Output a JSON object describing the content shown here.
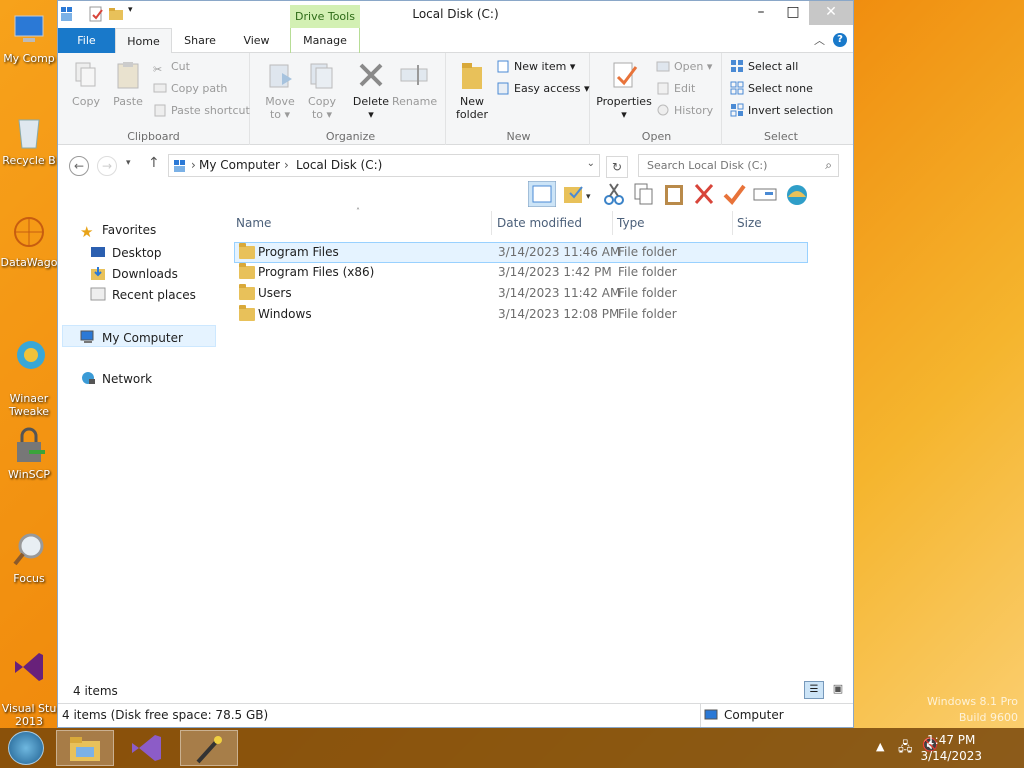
{
  "desktop": {
    "icons": [
      {
        "label": "My Comp"
      },
      {
        "label": "Recycle B"
      },
      {
        "label": "DataWago"
      },
      {
        "label": "Winaer\nTweake"
      },
      {
        "label": "WinSCP"
      },
      {
        "label": "Focus"
      },
      {
        "label": "Visual Stu\n2013"
      }
    ],
    "watermark_line1": "Windows 8.1 Pro",
    "watermark_line2": "Build 9600"
  },
  "window": {
    "title": "Local Disk (C:)",
    "contextual_tab": "Drive Tools",
    "tabs": {
      "file": "File",
      "home": "Home",
      "share": "Share",
      "view": "View",
      "manage": "Manage"
    },
    "ribbon": {
      "clipboard": {
        "label": "Clipboard",
        "copy": "Copy",
        "paste": "Paste",
        "cut": "Cut",
        "copy_path": "Copy path",
        "paste_shortcut": "Paste shortcut"
      },
      "organize": {
        "label": "Organize",
        "move_to": "Move",
        "move_to2": "to ▾",
        "copy_to": "Copy",
        "copy_to2": "to ▾",
        "delete": "Delete",
        "delete2": "▾",
        "rename": "Rename"
      },
      "new": {
        "label": "New",
        "new_folder": "New",
        "new_folder2": "folder",
        "new_item": "New item ▾",
        "easy_access": "Easy access ▾"
      },
      "open": {
        "label": "Open",
        "properties": "Properties",
        "properties2": "▾",
        "open": "Open ▾",
        "edit": "Edit",
        "history": "History"
      },
      "select": {
        "label": "Select",
        "select_all": "Select all",
        "select_none": "Select none",
        "invert_selection": "Invert selection"
      }
    },
    "address": {
      "crumbs": [
        "My Computer",
        "Local Disk (C:)"
      ]
    },
    "search": {
      "placeholder": "Search Local Disk (C:)"
    },
    "nav": {
      "favorites": "Favorites",
      "desktop": "Desktop",
      "downloads": "Downloads",
      "recent": "Recent places",
      "computer": "My Computer",
      "network": "Network"
    },
    "columns": {
      "name": "Name",
      "date": "Date modified",
      "type": "Type",
      "size": "Size"
    },
    "files": [
      {
        "name": "Program Files",
        "date": "3/14/2023 11:46 AM",
        "type": "File folder"
      },
      {
        "name": "Program Files (x86)",
        "date": "3/14/2023 1:42 PM",
        "type": "File folder"
      },
      {
        "name": "Users",
        "date": "3/14/2023 11:42 AM",
        "type": "File folder"
      },
      {
        "name": "Windows",
        "date": "3/14/2023 12:08 PM",
        "type": "File folder"
      }
    ],
    "item_count": "4 items",
    "status": {
      "left": "4 items (Disk free space: 78.5 GB)",
      "right": "Computer"
    }
  },
  "taskbar": {
    "time": "1:47 PM",
    "date": "3/14/2023"
  }
}
